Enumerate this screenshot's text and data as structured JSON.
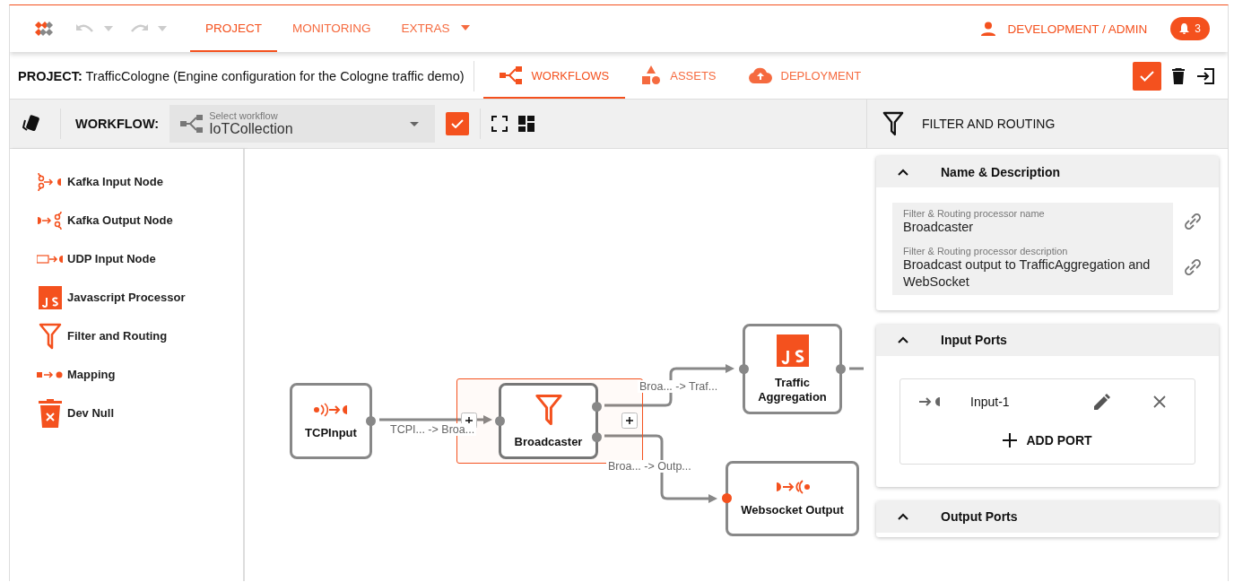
{
  "nav": {
    "tabs": [
      {
        "label": "PROJECT",
        "selected": true
      },
      {
        "label": "MONITORING",
        "selected": false
      },
      {
        "label": "EXTRAS",
        "selected": false,
        "dropdown": true
      }
    ],
    "user": "DEVELOPMENT / ADMIN",
    "notifications": "3"
  },
  "project": {
    "label": "PROJECT:",
    "name": "TrafficCologne (Engine configuration for the Cologne traffic demo)",
    "tabs": [
      {
        "label": "WORKFLOWS",
        "kind": "workflow",
        "selected": true
      },
      {
        "label": "ASSETS",
        "kind": "assets",
        "selected": false
      },
      {
        "label": "DEPLOYMENT",
        "kind": "deploy",
        "selected": false
      }
    ]
  },
  "workflow": {
    "label": "WORKFLOW:",
    "select_label": "Select workflow",
    "value": "IoTCollection"
  },
  "palette": [
    {
      "label": "Kafka Input Node",
      "kind": "kafka-in"
    },
    {
      "label": "Kafka Output Node",
      "kind": "kafka-out"
    },
    {
      "label": "UDP Input Node",
      "kind": "udp"
    },
    {
      "label": "Javascript Processor",
      "kind": "js"
    },
    {
      "label": "Filter and Routing",
      "kind": "filter"
    },
    {
      "label": "Mapping",
      "kind": "mapping"
    },
    {
      "label": "Dev Null",
      "kind": "devnull"
    }
  ],
  "canvas": {
    "nodes": [
      {
        "label": "TCPInput",
        "kind": "tcp-in",
        "selected": false
      },
      {
        "label": "Broadcaster",
        "kind": "filter",
        "selected": true
      },
      {
        "label": "Traffic Aggregation",
        "kind": "js",
        "selected": false
      },
      {
        "label": "Websocket Output",
        "kind": "ws-out",
        "selected": false,
        "input_highlighted": true
      }
    ],
    "edges": [
      {
        "label": "TCPI... -> Broa..."
      },
      {
        "label": "Broa... -> Traf..."
      },
      {
        "label": "Broa... -> Outp..."
      }
    ]
  },
  "panel": {
    "title": "FILTER AND ROUTING",
    "name_section": {
      "title": "Name & Description",
      "fields": [
        {
          "label": "Filter & Routing processor name",
          "value": "Broadcaster"
        },
        {
          "label": "Filter & Routing processor description",
          "value": "Broadcast output to TrafficAggregation and WebSocket"
        }
      ]
    },
    "input_section": {
      "title": "Input Ports",
      "ports": [
        {
          "name": "Input-1"
        }
      ],
      "add_label": "ADD PORT"
    },
    "output_section": {
      "title": "Output Ports"
    }
  }
}
